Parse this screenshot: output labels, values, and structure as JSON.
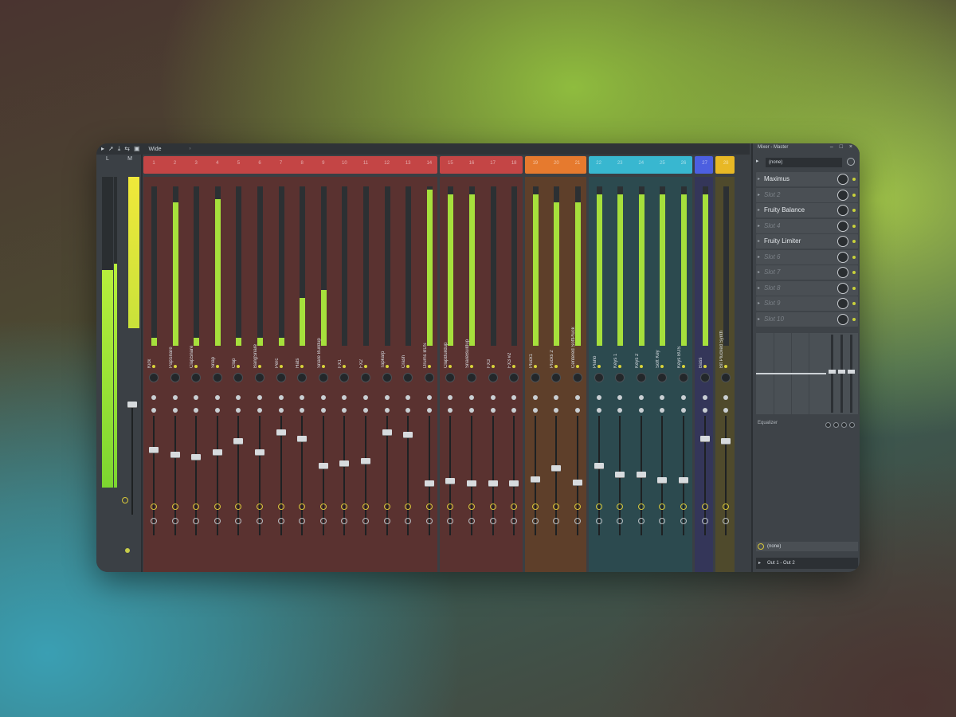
{
  "titlebar": {
    "title": "Wide",
    "arrow": "›"
  },
  "master": {
    "label_left": "L",
    "label_right": "M"
  },
  "groups": [
    {
      "color": "#c44545",
      "bg": "#5a3230",
      "from": 1,
      "to": 14
    },
    {
      "color": "#c44545",
      "bg": "#5a3230",
      "from": 15,
      "to": 18
    },
    {
      "color": "#e67a2e",
      "bg": "#5e3f2a",
      "from": 19,
      "to": 21
    },
    {
      "color": "#38b7d0",
      "bg": "#2c4a4f",
      "from": 22,
      "to": 26
    },
    {
      "color": "#4c5fe0",
      "bg": "#343659",
      "from": 27,
      "to": 27
    },
    {
      "color": "#e8b825",
      "bg": "#4f4a2c",
      "from": 28,
      "to": 28
    }
  ],
  "channels": [
    {
      "num": "1",
      "name": "Kick",
      "meter": 0.05,
      "fader": 0.72
    },
    {
      "num": "2",
      "name": "PapSnare",
      "meter": 0.9,
      "fader": 0.68
    },
    {
      "num": "3",
      "name": "ClapSnare",
      "meter": 0.05,
      "fader": 0.66
    },
    {
      "num": "4",
      "name": "Snap",
      "meter": 0.92,
      "fader": 0.7
    },
    {
      "num": "5",
      "name": "Clap",
      "meter": 0.05,
      "fader": 0.8
    },
    {
      "num": "6",
      "name": "BangSnare",
      "meter": 0.05,
      "fader": 0.7
    },
    {
      "num": "7",
      "name": "Perc",
      "meter": 0.05,
      "fader": 0.88
    },
    {
      "num": "8",
      "name": "Hats",
      "meter": 0.3,
      "fader": 0.82
    },
    {
      "num": "9",
      "name": "Snare Buildup",
      "meter": 0.35,
      "fader": 0.58
    },
    {
      "num": "10",
      "name": "FX1",
      "meter": 0.0,
      "fader": 0.6
    },
    {
      "num": "11",
      "name": "FX2",
      "meter": 0.0,
      "fader": 0.62
    },
    {
      "num": "12",
      "name": "Tapkarp",
      "meter": 0.0,
      "fader": 0.88
    },
    {
      "num": "13",
      "name": "Crash",
      "meter": 0.0,
      "fader": 0.86
    },
    {
      "num": "14",
      "name": "Drums BUS",
      "meter": 0.98,
      "fader": 0.42
    },
    {
      "num": "15",
      "name": "ClapBuildup",
      "meter": 0.95,
      "fader": 0.44
    },
    {
      "num": "16",
      "name": "SnareBuildup",
      "meter": 0.95,
      "fader": 0.42
    },
    {
      "num": "17",
      "name": "FX3",
      "meter": 0.0,
      "fader": 0.42
    },
    {
      "num": "18",
      "name": "FX3 #2",
      "meter": 0.0,
      "fader": 0.42
    },
    {
      "num": "19",
      "name": "Pluck1",
      "meter": 0.95,
      "fader": 0.46
    },
    {
      "num": "20",
      "name": "Plucks 2",
      "meter": 0.9,
      "fader": 0.56
    },
    {
      "num": "21",
      "name": "Centered SoftPluck",
      "meter": 0.9,
      "fader": 0.43
    },
    {
      "num": "22",
      "name": "Piano",
      "meter": 0.95,
      "fader": 0.58
    },
    {
      "num": "23",
      "name": "Keys 1",
      "meter": 0.95,
      "fader": 0.5
    },
    {
      "num": "24",
      "name": "Keys 2",
      "meter": 0.95,
      "fader": 0.5
    },
    {
      "num": "25",
      "name": "Soft Key",
      "meter": 0.95,
      "fader": 0.45
    },
    {
      "num": "26",
      "name": "Keys BUS",
      "meter": 0.95,
      "fader": 0.45
    },
    {
      "num": "27",
      "name": "Bass",
      "meter": 0.95,
      "fader": 0.82
    },
    {
      "num": "28",
      "name": "Bit Plucked Synth",
      "meter": 0.0,
      "fader": 0.8
    }
  ],
  "panel": {
    "title": "Mixer - Master",
    "controls": "– □ ×",
    "preset": "(none)",
    "slots": [
      {
        "label": "Maximus",
        "empty": false
      },
      {
        "label": "Slot 2",
        "empty": true
      },
      {
        "label": "Fruity Balance",
        "empty": false
      },
      {
        "label": "Slot 4",
        "empty": true
      },
      {
        "label": "Fruity Limiter",
        "empty": false
      },
      {
        "label": "Slot 6",
        "empty": true
      },
      {
        "label": "Slot 7",
        "empty": true
      },
      {
        "label": "Slot 8",
        "empty": true
      },
      {
        "label": "Slot 9",
        "empty": true
      },
      {
        "label": "Slot 10",
        "empty": true
      }
    ],
    "eq_label": "Equalizer",
    "input_route": "(none)",
    "output_route": "Out 1 - Out 2"
  },
  "colors": {
    "meter": "#a6e03c",
    "bg": "#3a3f44"
  }
}
